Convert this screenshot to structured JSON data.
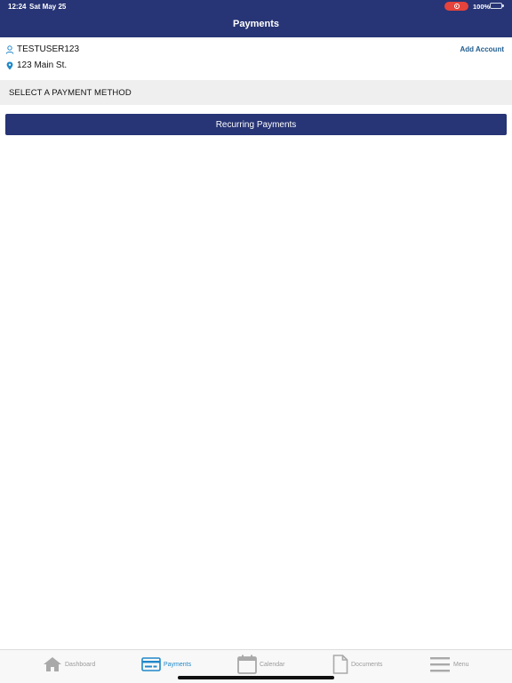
{
  "status_bar": {
    "time": "12:24",
    "date": "Sat May 25",
    "battery": "100%"
  },
  "header": {
    "title": "Payments"
  },
  "account": {
    "username": "TESTUSER123",
    "address": "123 Main St.",
    "add_account_label": "Add Account"
  },
  "section": {
    "title": "SELECT A PAYMENT METHOD"
  },
  "actions": {
    "recurring_label": "Recurring Payments"
  },
  "tabs": [
    {
      "label": "Dashboard",
      "icon": "home-icon"
    },
    {
      "label": "Payments",
      "icon": "credit-card-icon",
      "active": true
    },
    {
      "label": "Calendar",
      "icon": "calendar-icon"
    },
    {
      "label": "Documents",
      "icon": "document-icon"
    },
    {
      "label": "Menu",
      "icon": "menu-icon"
    }
  ],
  "colors": {
    "primary": "#273475",
    "accent": "#1f88c9",
    "link": "#1e5c8f",
    "inactive": "#9b9b9b"
  }
}
